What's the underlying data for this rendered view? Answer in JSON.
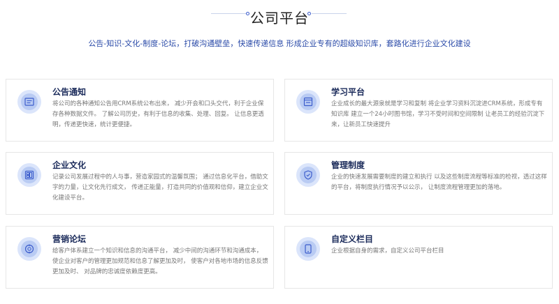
{
  "header": {
    "title": "公司平台",
    "subtitle": "公告-知识-文化-制度-论坛，打破沟通壁垒，快速传递信息 形成企业专有的超级知识库，套路化进行企业文化建设"
  },
  "colors": {
    "accent": "#2a4aa8",
    "icon_bg": "#dbe5fb",
    "icon_inner": "#b9cbf3",
    "card_border": "#e6e6e6"
  },
  "cards": [
    {
      "title": "公告通知",
      "icon": "announcement-icon",
      "desc": "将公司的各种通知公告用CRM系统公布出来， 减少开会和口头交代，利于企业保存各种数据文件。 了解公司历史，有利于信息的收集、处理、回复。 让信息更透明，传递更快速，统计更便捷。"
    },
    {
      "title": "学习平台",
      "icon": "study-icon",
      "desc": "企业成长的最大源泉就是学习和复制 将企业学习资料沉淀进CRM系统，形成专有知识库 建立一个24小时图书馆，学习不受时间和空间限制 让老员工的经验沉淀下来，让新员工快速提升"
    },
    {
      "title": "企业文化",
      "icon": "culture-icon",
      "desc": "记录公司发展过程中的人与事，营造家园式的温馨氛围； 通过信息化平台，借助文字的力量，让文化先行成文， 传递正能量，打造共同的价值观和信仰，建立企业文化建设平台。"
    },
    {
      "title": "管理制度",
      "icon": "policy-icon",
      "desc": "企业的快速发展需要制度的建立和执行 以及这些制度流程等标准的检视，透过这样的平台，将制度执行情况予以公示， 让制度流程管理更加的落地。"
    },
    {
      "title": "营销论坛",
      "icon": "forum-icon",
      "desc": "给客户体系建立一个知识和信息的沟通平台， 减少中间的沟通环节和沟通成本， 使企业对客户的管理更加规范和信息了解更加及时， 使客户对各地市场的信息反馈更加及时、 对品牌的忠诚度依赖度更高。"
    },
    {
      "title": "自定义栏目",
      "icon": "custom-column-icon",
      "desc": "企业根据自身的需求，自定义公司平台栏目"
    }
  ]
}
